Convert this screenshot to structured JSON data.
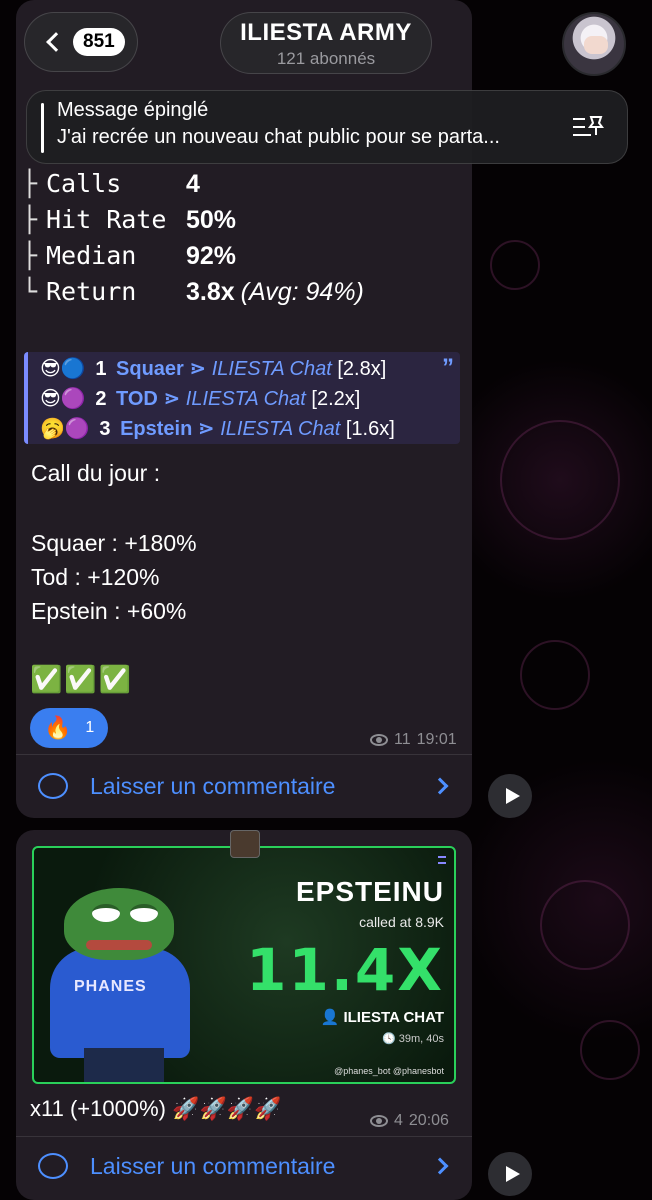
{
  "header": {
    "back_count": "851",
    "channel_title": "ILIESTA ARMY",
    "channel_subtitle": "121 abonnés"
  },
  "pinned": {
    "title": "Message épinglé",
    "text": "J'ai recrée un nouveau chat public pour se parta..."
  },
  "message1": {
    "stats": [
      {
        "tree": "├",
        "label": "Calls",
        "value": "4",
        "extra": ""
      },
      {
        "tree": "├",
        "label": "Hit Rate",
        "value": "50%",
        "extra": ""
      },
      {
        "tree": "├",
        "label": "Median",
        "value": "92%",
        "extra": ""
      },
      {
        "tree": "└",
        "label": "Return",
        "value": "3.8x",
        "extra": "(Avg: 94%)"
      }
    ],
    "leaderboard": [
      {
        "emoji": "😎🔵",
        "rank": "1",
        "name": "Squaer",
        "sep": "⋗",
        "chat": "ILIESTA Chat",
        "mult": "[2.8x]"
      },
      {
        "emoji": "😎🟣",
        "rank": "2",
        "name": "TOD",
        "sep": "⋗",
        "chat": "ILIESTA Chat",
        "mult": "[2.2x]"
      },
      {
        "emoji": "🥱🟣",
        "rank": "3",
        "name": "Epstein",
        "sep": "⋗",
        "chat": "ILIESTA Chat",
        "mult": "[1.6x]"
      }
    ],
    "quote_mark": "”",
    "call_title": "Call du jour :",
    "calls": [
      "Squaer : +180%",
      "Tod : +120%",
      "Epstein : +60%"
    ],
    "checks": "✅✅✅",
    "reaction_emoji": "🔥",
    "reaction_count": "1",
    "views": "11",
    "time": "19:01",
    "comment_label": "Laisser un commentaire"
  },
  "message2": {
    "card": {
      "brand": "PHANES",
      "token": "EPSTEINU",
      "called_at": "called at 8.9K",
      "multiplier": "11.4X",
      "chat": "ILIESTA CHAT",
      "duration": "39m, 40s",
      "footer": "@phanes_bot   @phanesbot"
    },
    "text": "x11 (+1000%) 🚀🚀🚀🚀",
    "views": "4",
    "time": "20:06",
    "comment_label": "Laisser un commentaire"
  },
  "colors": {
    "accent": "#4d8fff",
    "bubble": "#221c24",
    "reaction": "#3a7ef0",
    "card_green": "#34e06a"
  }
}
